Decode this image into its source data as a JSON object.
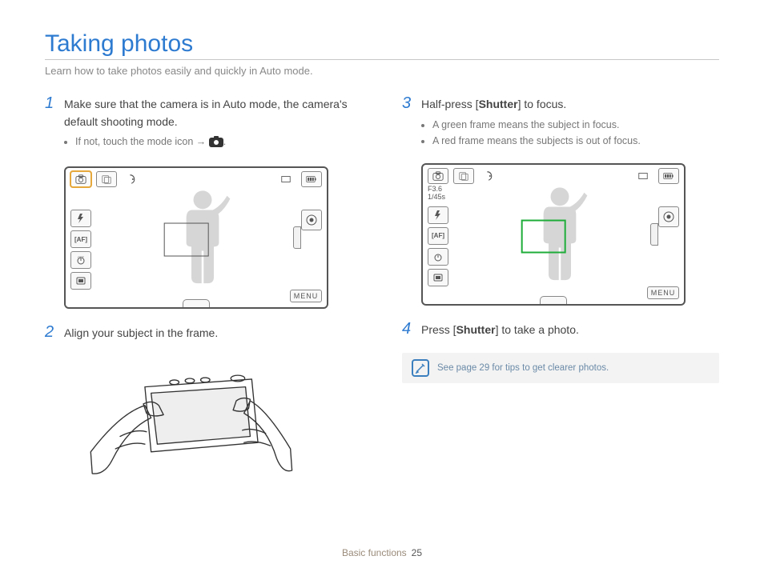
{
  "title": "Taking photos",
  "subtitle": "Learn how to take photos easily and quickly in Auto mode.",
  "steps": {
    "s1": {
      "num": "1",
      "text": "Make sure that the camera is in Auto mode, the camera's default shooting mode.",
      "bullet": "If not, touch the mode icon →"
    },
    "s2": {
      "num": "2",
      "text": "Align your subject in the frame."
    },
    "s3": {
      "num": "3",
      "text_pre": "Half-press [",
      "text_bold": "Shutter",
      "text_post": "] to focus.",
      "bullets": [
        "A green frame means the subject in focus.",
        "A red frame means the subjects is out of focus."
      ]
    },
    "s4": {
      "num": "4",
      "text_pre": "Press [",
      "text_bold": "Shutter",
      "text_post": "] to take a photo."
    }
  },
  "lcd": {
    "exposure_f": "F3.6",
    "exposure_s": "1/45s",
    "menu": "MENU",
    "leftIcons": [
      "flash-auto",
      "af-mode",
      "timer-off",
      "display"
    ],
    "topIcons": [
      "camera-mode",
      "capture-type",
      "stabilizer"
    ],
    "rightTop": [
      "size",
      "battery"
    ],
    "rightIcons": [
      "record"
    ]
  },
  "tip": "See page 29 for tips to get clearer photos.",
  "footer": {
    "section": "Basic functions",
    "page": "25"
  }
}
